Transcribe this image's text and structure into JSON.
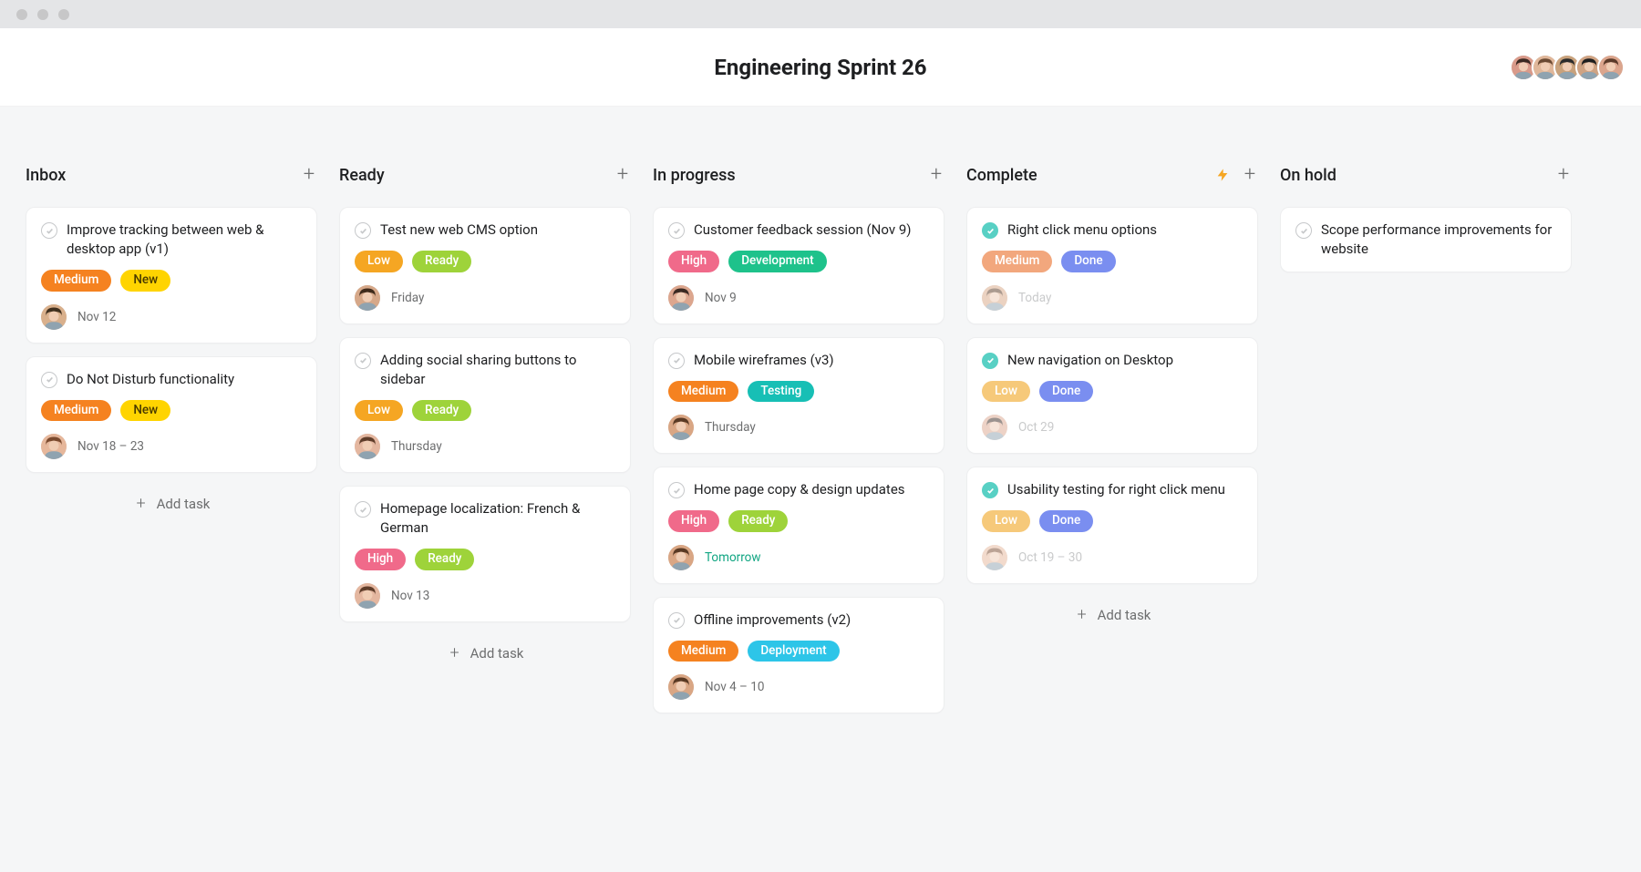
{
  "window": {
    "traffic_dots": 3
  },
  "header": {
    "title": "Engineering Sprint 26",
    "team_avatars": [
      {
        "name": "user-1",
        "bg": "#d99a8a",
        "hair": "#3b2a22"
      },
      {
        "name": "user-2",
        "bg": "#e0b79a",
        "hair": "#6b4a33"
      },
      {
        "name": "user-3",
        "bg": "#c9a27c",
        "hair": "#2c2c2c"
      },
      {
        "name": "user-4",
        "bg": "#cfa383",
        "hair": "#1f1f1f"
      },
      {
        "name": "user-5",
        "bg": "#dba58d",
        "hair": "#5a3a29"
      }
    ]
  },
  "ui": {
    "add_task_label": "Add task",
    "colors": {
      "priority": {
        "High": "#f06a8a",
        "Medium": "#f58220",
        "Low": "#f5a623"
      },
      "status": {
        "New": "#ffd400",
        "Ready": "#9ed33a",
        "Development": "#1ec28b",
        "Testing": "#17bfb5",
        "Deployment": "#2dc5e8",
        "Done": "#7a8ef0",
        "priority_Medium_complete": "#f2a77d",
        "priority_Low_complete": "#f6c97a"
      }
    }
  },
  "board": {
    "columns": [
      {
        "id": "inbox",
        "title": "Inbox",
        "has_bolt": false,
        "cards": [
          {
            "id": "c1",
            "title": "Improve tracking between web & desktop app (v1)",
            "done": false,
            "tags": [
              {
                "text": "Medium",
                "color": "#f58220"
              },
              {
                "text": "New",
                "color": "#ffd400",
                "fg": "#4a3b00"
              }
            ],
            "avatar": {
              "bg": "#d9b08c",
              "hair": "#40301f"
            },
            "date": "Nov 12"
          },
          {
            "id": "c2",
            "title": "Do Not Disturb functionality",
            "done": false,
            "tags": [
              {
                "text": "Medium",
                "color": "#f58220"
              },
              {
                "text": "New",
                "color": "#ffd400",
                "fg": "#4a3b00"
              }
            ],
            "avatar": {
              "bg": "#e6b79b",
              "hair": "#7a4a2e"
            },
            "date": "Nov 18 – 23"
          }
        ],
        "show_add": true
      },
      {
        "id": "ready",
        "title": "Ready",
        "has_bolt": false,
        "cards": [
          {
            "id": "c3",
            "title": "Test new web CMS option",
            "done": false,
            "tags": [
              {
                "text": "Low",
                "color": "#f5a623"
              },
              {
                "text": "Ready",
                "color": "#9ed33a"
              }
            ],
            "avatar": {
              "bg": "#d6a889",
              "hair": "#3f2b1c"
            },
            "date": "Friday"
          },
          {
            "id": "c4",
            "title": "Adding social sharing buttons to sidebar",
            "done": false,
            "tags": [
              {
                "text": "Low",
                "color": "#f5a623"
              },
              {
                "text": "Ready",
                "color": "#9ed33a"
              }
            ],
            "avatar": {
              "bg": "#e4b7a0",
              "hair": "#5f3d2a"
            },
            "date": "Thursday"
          },
          {
            "id": "c5",
            "title": "Homepage localization: French & German",
            "done": false,
            "tags": [
              {
                "text": "High",
                "color": "#f06a8a"
              },
              {
                "text": "Ready",
                "color": "#9ed33a"
              }
            ],
            "avatar": {
              "bg": "#e4b7a0",
              "hair": "#5f3d2a"
            },
            "date": "Nov 13"
          }
        ],
        "show_add": true
      },
      {
        "id": "inprogress",
        "title": "In progress",
        "has_bolt": false,
        "cards": [
          {
            "id": "c6",
            "title": "Customer feedback session (Nov 9)",
            "done": false,
            "tags": [
              {
                "text": "High",
                "color": "#f06a8a"
              },
              {
                "text": "Development",
                "color": "#1ec28b"
              }
            ],
            "avatar": {
              "bg": "#dca68e",
              "hair": "#3a2a22"
            },
            "date": "Nov 9"
          },
          {
            "id": "c7",
            "title": "Mobile wireframes (v3)",
            "done": false,
            "tags": [
              {
                "text": "Medium",
                "color": "#f58220"
              },
              {
                "text": "Testing",
                "color": "#17bfb5"
              }
            ],
            "avatar": {
              "bg": "#d9a684",
              "hair": "#5a3a24"
            },
            "date": "Thursday"
          },
          {
            "id": "c8",
            "title": "Home page copy & design updates",
            "done": false,
            "tags": [
              {
                "text": "High",
                "color": "#f06a8a"
              },
              {
                "text": "Ready",
                "color": "#9ed33a"
              }
            ],
            "avatar": {
              "bg": "#d9a684",
              "hair": "#5a3a24"
            },
            "date": "Tomorrow",
            "date_accent": true
          },
          {
            "id": "c9",
            "title": "Offline improvements (v2)",
            "done": false,
            "tags": [
              {
                "text": "Medium",
                "color": "#f58220"
              },
              {
                "text": "Deployment",
                "color": "#2dc5e8"
              }
            ],
            "avatar": {
              "bg": "#d9a684",
              "hair": "#5a3a24"
            },
            "date": "Nov 4 – 10"
          }
        ],
        "show_add": false
      },
      {
        "id": "complete",
        "title": "Complete",
        "has_bolt": true,
        "cards": [
          {
            "id": "c10",
            "title": "Right click menu options",
            "done": true,
            "tags": [
              {
                "text": "Medium",
                "color": "#f2a77d"
              },
              {
                "text": "Done",
                "color": "#7a8ef0"
              }
            ],
            "avatar": {
              "bg": "#d9a684",
              "hair": "#5a3a24",
              "faded": true
            },
            "date": "Today",
            "date_faded": true
          },
          {
            "id": "c11",
            "title": "New navigation on Desktop",
            "done": true,
            "tags": [
              {
                "text": "Low",
                "color": "#f6c97a"
              },
              {
                "text": "Done",
                "color": "#7a8ef0"
              }
            ],
            "avatar": {
              "bg": "#dca68e",
              "hair": "#3a2a22",
              "faded": true
            },
            "date": "Oct 29",
            "date_faded": true
          },
          {
            "id": "c12",
            "title": "Usability testing for right click menu",
            "done": true,
            "tags": [
              {
                "text": "Low",
                "color": "#f6c97a"
              },
              {
                "text": "Done",
                "color": "#7a8ef0"
              }
            ],
            "avatar": {
              "bg": "#e6b79b",
              "hair": "#7a4a2e",
              "faded": true
            },
            "date": "Oct 19 – 30",
            "date_faded": true
          }
        ],
        "show_add": true
      },
      {
        "id": "onhold",
        "title": "On hold",
        "has_bolt": false,
        "cards": [
          {
            "id": "c13",
            "title": "Scope performance improvements for website",
            "done": false,
            "tags": [],
            "no_meta": true
          }
        ],
        "show_add": false
      }
    ]
  }
}
